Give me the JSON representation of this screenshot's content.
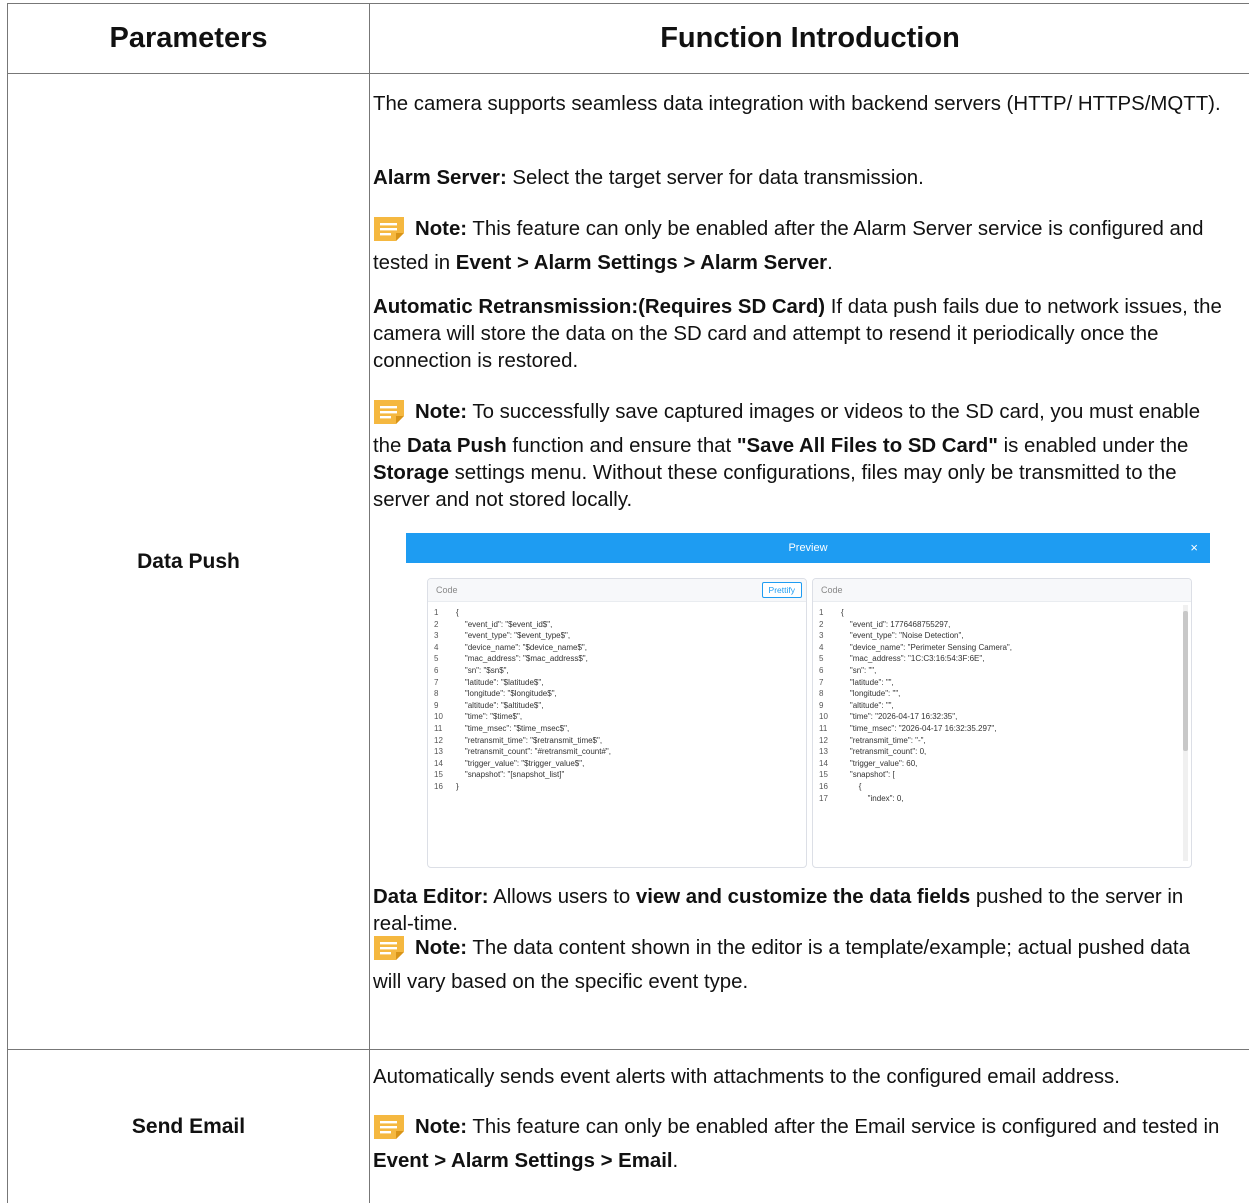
{
  "table": {
    "header": {
      "col1": "Parameters",
      "col2": "Function Introduction"
    },
    "rows": [
      {
        "parameter": "Data Push",
        "p1": "The camera supports seamless data integration with backend servers (HTTP/ HTTPS/MQTT).",
        "alarm_server": {
          "label": "Alarm Server:",
          "text": " Select the target server for data transmission."
        },
        "note1": {
          "label": "Note:",
          "text_a": "  This feature can only be enabled after the Alarm Server service is configured and tested in ",
          "path": "Event > Alarm Settings > Alarm Server",
          "end": "."
        },
        "retrans": {
          "label": "Automatic Retransmission:(Requires SD Card)",
          "text": " If data push fails due to network issues, the camera will store the data on the SD card and attempt to resend it periodically once the connection is restored."
        },
        "note2": {
          "label": "Note:",
          "t1": "  To successfully save captured images or videos to the SD card, you must enable the ",
          "b1": "Data Push",
          "t2": " function and ensure that ",
          "b2": "\"Save All Files to SD Card\"",
          "t3": " is enabled under the ",
          "b3": "Storage",
          "t4": " settings menu. Without these configurations, files may only be transmitted to the server and not stored locally."
        },
        "editor": {
          "label": "Data Editor:",
          "t1": " Allows users to ",
          "b1": "view and customize the data fields",
          "t2": " pushed to the server in real-time."
        },
        "note3": {
          "label": "Note:",
          "text": "  The data content shown in the editor is a template/example; actual pushed data will vary based on the specific event type."
        }
      },
      {
        "parameter": "Send Email",
        "p1": "Automatically sends event alerts with attachments to the configured email address.",
        "note": {
          "label": "Note:",
          "text_a": "  This feature can only be enabled after the Email service is configured and tested in ",
          "path": "Event > Alarm Settings > Email",
          "end": "."
        }
      }
    ]
  },
  "preview": {
    "title": "Preview",
    "close": "×",
    "left_panel": {
      "title": "Code",
      "button": "Prettify",
      "lines": [
        [
          "1",
          "{"
        ],
        [
          "2",
          "    \"event_id\": \"$event_id$\","
        ],
        [
          "3",
          "    \"event_type\": \"$event_type$\","
        ],
        [
          "4",
          "    \"device_name\": \"$device_name$\","
        ],
        [
          "5",
          "    \"mac_address\": \"$mac_address$\","
        ],
        [
          "6",
          "    \"sn\": \"$sn$\","
        ],
        [
          "7",
          "    \"latitude\": \"$latitude$\","
        ],
        [
          "8",
          "    \"longitude\": \"$longitude$\","
        ],
        [
          "9",
          "    \"altitude\": \"$altitude$\","
        ],
        [
          "10",
          "    \"time\": \"$time$\","
        ],
        [
          "11",
          "    \"time_msec\": \"$time_msec$\","
        ],
        [
          "12",
          "    \"retransmit_time\": \"$retransmit_time$\","
        ],
        [
          "13",
          "    \"retransmit_count\": \"#retransmit_count#\","
        ],
        [
          "14",
          "    \"trigger_value\": \"$trigger_value$\","
        ],
        [
          "15",
          "    \"snapshot\": \"[snapshot_list]\""
        ],
        [
          "16",
          "}"
        ]
      ]
    },
    "right_panel": {
      "title": "Code",
      "lines": [
        [
          "1",
          "{"
        ],
        [
          "2",
          "    \"event_id\": 1776468755297,"
        ],
        [
          "3",
          "    \"event_type\": \"Noise Detection\","
        ],
        [
          "4",
          "    \"device_name\": \"Perimeter Sensing Camera\","
        ],
        [
          "5",
          "    \"mac_address\": \"1C:C3:16:54:3F:6E\","
        ],
        [
          "6",
          "    \"sn\": \"\","
        ],
        [
          "7",
          "    \"latitude\": \"\","
        ],
        [
          "8",
          "    \"longitude\": \"\","
        ],
        [
          "9",
          "    \"altitude\": \"\","
        ],
        [
          "10",
          "    \"time\": \"2026-04-17 16:32:35\","
        ],
        [
          "11",
          "    \"time_msec\": \"2026-04-17 16:32:35.297\","
        ],
        [
          "12",
          "    \"retransmit_time\": \"-\","
        ],
        [
          "13",
          "    \"retransmit_count\": 0,"
        ],
        [
          "14",
          "    \"trigger_value\": 60,"
        ],
        [
          "15",
          "    \"snapshot\": ["
        ],
        [
          "16",
          "        {"
        ],
        [
          "17",
          "            \"index\": 0,"
        ]
      ]
    }
  }
}
